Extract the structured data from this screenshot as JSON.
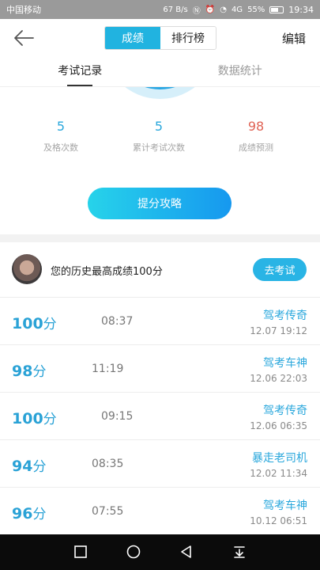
{
  "status": {
    "carrier": "中国移动",
    "speed": "67 B/s",
    "signal": "4G",
    "battery": "55%",
    "time": "19:34"
  },
  "nav": {
    "tab_active": "成绩",
    "tab_inactive": "排行榜",
    "edit": "编辑"
  },
  "subtabs": {
    "records": "考试记录",
    "stats": "数据统计"
  },
  "stats": [
    {
      "value": "5",
      "label": "及格次数"
    },
    {
      "value": "5",
      "label": "累计考试次数"
    },
    {
      "value": "98",
      "label": "成绩预测"
    }
  ],
  "boost_label": "提分攻略",
  "best": {
    "text": "您的历史最高成绩100分",
    "button": "去考试"
  },
  "records": [
    {
      "score": "100",
      "unit": "分",
      "duration": "08:37",
      "title": "驾考传奇",
      "date": "12.07  19:12"
    },
    {
      "score": "98",
      "unit": "分",
      "duration": "11:19",
      "title": "驾考车神",
      "date": "12.06  22:03"
    },
    {
      "score": "100",
      "unit": "分",
      "duration": "09:15",
      "title": "驾考传奇",
      "date": "12.06  06:35"
    },
    {
      "score": "94",
      "unit": "分",
      "duration": "08:35",
      "title": "暴走老司机",
      "date": "12.02  11:34"
    },
    {
      "score": "96",
      "unit": "分",
      "duration": "07:55",
      "title": "驾考车神",
      "date": "10.12  06:51"
    }
  ],
  "colors": {
    "accent": "#29a7dc",
    "prediction": "#e06355",
    "status_bar": "#9a9a9a"
  }
}
